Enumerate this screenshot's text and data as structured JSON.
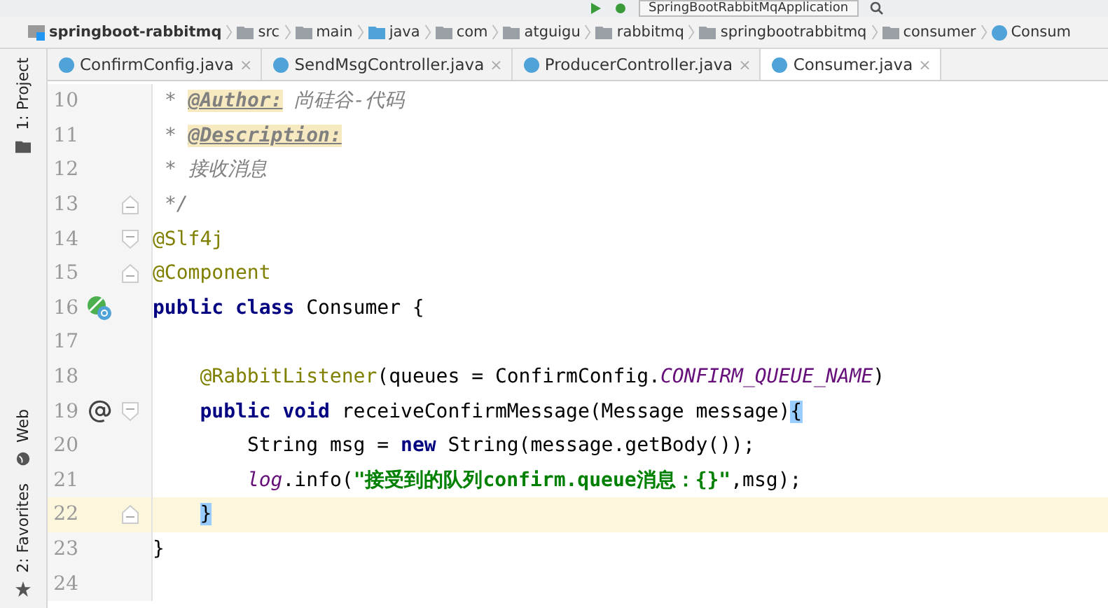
{
  "toolbar": {
    "run_config": "SpringBootRabbitMqApplication"
  },
  "breadcrumb": [
    {
      "label": "springboot-rabbitmq",
      "kind": "module"
    },
    {
      "label": "src",
      "kind": "folder"
    },
    {
      "label": "main",
      "kind": "folder"
    },
    {
      "label": "java",
      "kind": "source"
    },
    {
      "label": "com",
      "kind": "folder"
    },
    {
      "label": "atguigu",
      "kind": "folder"
    },
    {
      "label": "rabbitmq",
      "kind": "folder"
    },
    {
      "label": "springbootrabbitmq",
      "kind": "folder"
    },
    {
      "label": "consumer",
      "kind": "folder"
    },
    {
      "label": "Consum",
      "kind": "class"
    }
  ],
  "side_tools": [
    {
      "label": "1: Project",
      "kind": "folder"
    },
    {
      "label": "Web",
      "kind": "globe"
    },
    {
      "label": "2: Favorites",
      "kind": "star"
    }
  ],
  "tabs": [
    {
      "label": "ConfirmConfig.java",
      "close": "×",
      "selected": false
    },
    {
      "label": "SendMsgController.java",
      "close": "×",
      "selected": false
    },
    {
      "label": "ProducerController.java",
      "close": "×",
      "selected": false
    },
    {
      "label": "Consumer.java",
      "close": "×",
      "selected": true
    }
  ],
  "lines": [
    {
      "number": "10",
      "current": false,
      "tokens": [
        {
          "text": " * ",
          "kind": "comment"
        },
        {
          "text": "@Author:",
          "kind": "doctag"
        },
        {
          "text": " 尚硅谷-代码",
          "kind": "comment"
        }
      ]
    },
    {
      "number": "11",
      "current": false,
      "tokens": [
        {
          "text": " * ",
          "kind": "comment"
        },
        {
          "text": "@Description:",
          "kind": "doctag"
        }
      ]
    },
    {
      "number": "12",
      "current": false,
      "tokens": [
        {
          "text": " * 接收消息",
          "kind": "comment"
        }
      ]
    },
    {
      "number": "13",
      "current": false,
      "fold": {
        "kind": "end"
      },
      "tokens": [
        {
          "text": " */",
          "kind": "comment"
        }
      ]
    },
    {
      "number": "14",
      "current": false,
      "fold": {
        "kind": "start"
      },
      "tokens": [
        {
          "text": "@Slf4j",
          "kind": "annotation"
        }
      ]
    },
    {
      "number": "15",
      "current": false,
      "fold": {
        "kind": "end"
      },
      "tokens": [
        {
          "text": "@Component",
          "kind": "annotation"
        }
      ]
    },
    {
      "number": "16",
      "current": false,
      "gutter_icon": {
        "kind": "bean"
      },
      "tokens": [
        {
          "text": "public class ",
          "kind": "keyword"
        },
        {
          "text": "Consumer {",
          "kind": "plain"
        }
      ]
    },
    {
      "number": "17",
      "current": false
    },
    {
      "number": "18",
      "current": false,
      "tokens": [
        {
          "text": "    @RabbitListener",
          "kind": "annotation"
        },
        {
          "text": "(queues = ConfirmConfig.",
          "kind": "plain"
        },
        {
          "text": "CONFIRM_QUEUE_NAME",
          "kind": "static"
        },
        {
          "text": ")",
          "kind": "plain"
        }
      ]
    },
    {
      "number": "19",
      "current": false,
      "gutter_icon": {
        "kind": "at"
      },
      "fold": {
        "kind": "start"
      },
      "tokens": [
        {
          "text": "    public void ",
          "kind": "keyword"
        },
        {
          "text": "receiveConfirmMessage(Message message)",
          "kind": "plain"
        },
        {
          "text": "{",
          "kind": "match"
        }
      ]
    },
    {
      "number": "20",
      "current": false,
      "tokens": [
        {
          "text": "        String msg = ",
          "kind": "plain"
        },
        {
          "text": "new ",
          "kind": "keyword"
        },
        {
          "text": "String(message.getBody());",
          "kind": "plain"
        }
      ]
    },
    {
      "number": "21",
      "current": false,
      "tokens": [
        {
          "text": "        log",
          "kind": "static"
        },
        {
          "text": ".info(",
          "kind": "plain"
        },
        {
          "text": "\"接受到的队列confirm.queue消息：{}\"",
          "kind": "string"
        },
        {
          "text": ",msg);",
          "kind": "plain"
        }
      ]
    },
    {
      "number": "22",
      "current": true,
      "fold": {
        "kind": "end"
      },
      "tokens": [
        {
          "text": "    }",
          "kind": "match"
        }
      ]
    },
    {
      "number": "23",
      "current": false,
      "tokens": [
        {
          "text": "}",
          "kind": "plain"
        }
      ]
    },
    {
      "number": "24",
      "current": false
    }
  ]
}
